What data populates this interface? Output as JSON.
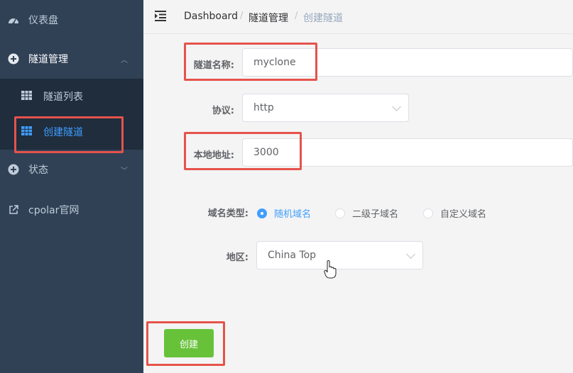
{
  "sidebar": {
    "dashboard_label": "仪表盘",
    "tunnel_mgmt_label": "隧道管理",
    "tunnel_list_label": "隧道列表",
    "create_tunnel_label": "创建隧道",
    "status_label": "状态",
    "cpolar_label": "cpolar官网"
  },
  "breadcrumb": {
    "items": [
      "Dashboard",
      "隧道管理",
      "创建隧道"
    ],
    "separator": "/"
  },
  "form": {
    "tunnel_name_label": "隧道名称:",
    "tunnel_name_value": "myclone",
    "protocol_label": "协议:",
    "protocol_value": "http",
    "local_addr_label": "本地地址:",
    "local_addr_value": "3000",
    "domain_type_label": "域名类型:",
    "domain_options": [
      "随机域名",
      "二级子域名",
      "自定义域名"
    ],
    "domain_selected": "随机域名",
    "region_label": "地区:",
    "region_value": "China Top",
    "submit_label": "创建"
  },
  "colors": {
    "sidebar_bg": "#304156",
    "active": "#409eff",
    "create_button": "#67c23a",
    "highlight": "#e5534b"
  }
}
